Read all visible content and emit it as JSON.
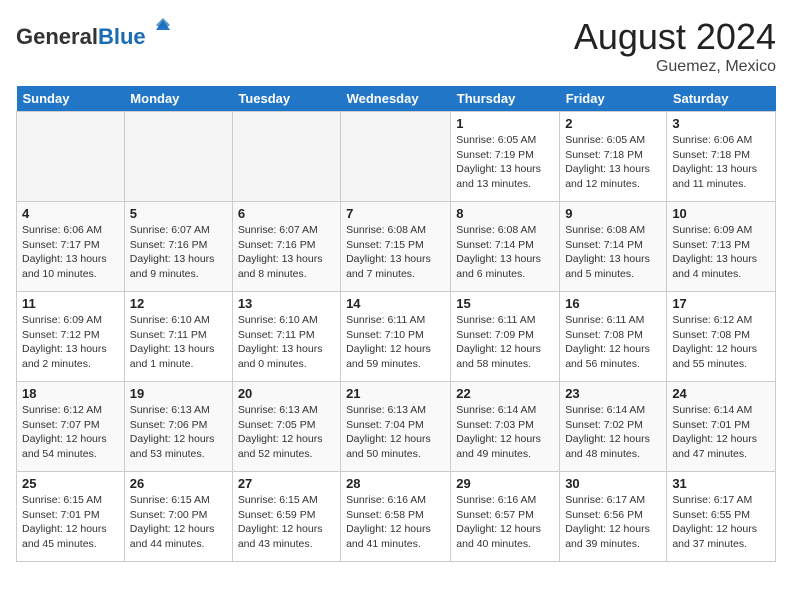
{
  "header": {
    "logo_general": "General",
    "logo_blue": "Blue",
    "month_title": "August 2024",
    "location": "Guemez, Mexico"
  },
  "days_of_week": [
    "Sunday",
    "Monday",
    "Tuesday",
    "Wednesday",
    "Thursday",
    "Friday",
    "Saturday"
  ],
  "weeks": [
    [
      {
        "day": "",
        "info": ""
      },
      {
        "day": "",
        "info": ""
      },
      {
        "day": "",
        "info": ""
      },
      {
        "day": "",
        "info": ""
      },
      {
        "day": "1",
        "info": "Sunrise: 6:05 AM\nSunset: 7:19 PM\nDaylight: 13 hours and 13 minutes."
      },
      {
        "day": "2",
        "info": "Sunrise: 6:05 AM\nSunset: 7:18 PM\nDaylight: 13 hours and 12 minutes."
      },
      {
        "day": "3",
        "info": "Sunrise: 6:06 AM\nSunset: 7:18 PM\nDaylight: 13 hours and 11 minutes."
      }
    ],
    [
      {
        "day": "4",
        "info": "Sunrise: 6:06 AM\nSunset: 7:17 PM\nDaylight: 13 hours and 10 minutes."
      },
      {
        "day": "5",
        "info": "Sunrise: 6:07 AM\nSunset: 7:16 PM\nDaylight: 13 hours and 9 minutes."
      },
      {
        "day": "6",
        "info": "Sunrise: 6:07 AM\nSunset: 7:16 PM\nDaylight: 13 hours and 8 minutes."
      },
      {
        "day": "7",
        "info": "Sunrise: 6:08 AM\nSunset: 7:15 PM\nDaylight: 13 hours and 7 minutes."
      },
      {
        "day": "8",
        "info": "Sunrise: 6:08 AM\nSunset: 7:14 PM\nDaylight: 13 hours and 6 minutes."
      },
      {
        "day": "9",
        "info": "Sunrise: 6:08 AM\nSunset: 7:14 PM\nDaylight: 13 hours and 5 minutes."
      },
      {
        "day": "10",
        "info": "Sunrise: 6:09 AM\nSunset: 7:13 PM\nDaylight: 13 hours and 4 minutes."
      }
    ],
    [
      {
        "day": "11",
        "info": "Sunrise: 6:09 AM\nSunset: 7:12 PM\nDaylight: 13 hours and 2 minutes."
      },
      {
        "day": "12",
        "info": "Sunrise: 6:10 AM\nSunset: 7:11 PM\nDaylight: 13 hours and 1 minute."
      },
      {
        "day": "13",
        "info": "Sunrise: 6:10 AM\nSunset: 7:11 PM\nDaylight: 13 hours and 0 minutes."
      },
      {
        "day": "14",
        "info": "Sunrise: 6:11 AM\nSunset: 7:10 PM\nDaylight: 12 hours and 59 minutes."
      },
      {
        "day": "15",
        "info": "Sunrise: 6:11 AM\nSunset: 7:09 PM\nDaylight: 12 hours and 58 minutes."
      },
      {
        "day": "16",
        "info": "Sunrise: 6:11 AM\nSunset: 7:08 PM\nDaylight: 12 hours and 56 minutes."
      },
      {
        "day": "17",
        "info": "Sunrise: 6:12 AM\nSunset: 7:08 PM\nDaylight: 12 hours and 55 minutes."
      }
    ],
    [
      {
        "day": "18",
        "info": "Sunrise: 6:12 AM\nSunset: 7:07 PM\nDaylight: 12 hours and 54 minutes."
      },
      {
        "day": "19",
        "info": "Sunrise: 6:13 AM\nSunset: 7:06 PM\nDaylight: 12 hours and 53 minutes."
      },
      {
        "day": "20",
        "info": "Sunrise: 6:13 AM\nSunset: 7:05 PM\nDaylight: 12 hours and 52 minutes."
      },
      {
        "day": "21",
        "info": "Sunrise: 6:13 AM\nSunset: 7:04 PM\nDaylight: 12 hours and 50 minutes."
      },
      {
        "day": "22",
        "info": "Sunrise: 6:14 AM\nSunset: 7:03 PM\nDaylight: 12 hours and 49 minutes."
      },
      {
        "day": "23",
        "info": "Sunrise: 6:14 AM\nSunset: 7:02 PM\nDaylight: 12 hours and 48 minutes."
      },
      {
        "day": "24",
        "info": "Sunrise: 6:14 AM\nSunset: 7:01 PM\nDaylight: 12 hours and 47 minutes."
      }
    ],
    [
      {
        "day": "25",
        "info": "Sunrise: 6:15 AM\nSunset: 7:01 PM\nDaylight: 12 hours and 45 minutes."
      },
      {
        "day": "26",
        "info": "Sunrise: 6:15 AM\nSunset: 7:00 PM\nDaylight: 12 hours and 44 minutes."
      },
      {
        "day": "27",
        "info": "Sunrise: 6:15 AM\nSunset: 6:59 PM\nDaylight: 12 hours and 43 minutes."
      },
      {
        "day": "28",
        "info": "Sunrise: 6:16 AM\nSunset: 6:58 PM\nDaylight: 12 hours and 41 minutes."
      },
      {
        "day": "29",
        "info": "Sunrise: 6:16 AM\nSunset: 6:57 PM\nDaylight: 12 hours and 40 minutes."
      },
      {
        "day": "30",
        "info": "Sunrise: 6:17 AM\nSunset: 6:56 PM\nDaylight: 12 hours and 39 minutes."
      },
      {
        "day": "31",
        "info": "Sunrise: 6:17 AM\nSunset: 6:55 PM\nDaylight: 12 hours and 37 minutes."
      }
    ]
  ]
}
